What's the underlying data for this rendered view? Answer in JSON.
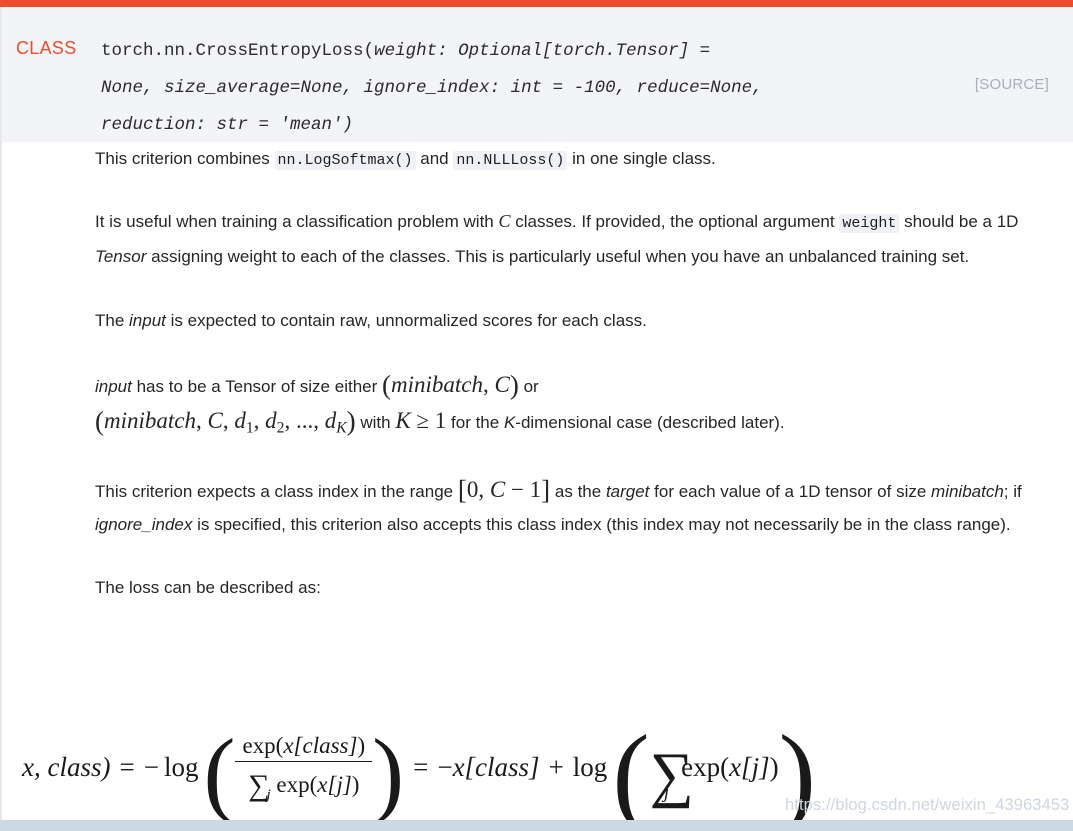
{
  "theme": {
    "brand_color": "#ee4c2c",
    "signature_bg": "#f3f4f7",
    "inline_code_bg": "#eff1f6",
    "source_link_color": "#a9aeb8",
    "body_text_color": "#262626",
    "watermark_color": "#cdd6e0",
    "bottom_strip_color": "#ccd9e4"
  },
  "signature": {
    "kind_label": "CLASS",
    "name": "torch.nn.CrossEntropyLoss",
    "open_paren": "(",
    "params_line1": "weight: Optional[torch.Tensor] =",
    "params_line2": "None, size_average=None, ignore_index: int = -100, reduce=None,",
    "params_line3": "reduction: str = 'mean')",
    "source_link": "[SOURCE]"
  },
  "body": {
    "p1": {
      "t1": "This criterion combines ",
      "code1": "nn.LogSoftmax()",
      "t2": " and ",
      "code2": "nn.NLLLoss()",
      "t3": " in one single class."
    },
    "p2": {
      "t1": "It is useful when training a classification problem with ",
      "var_c": "C",
      "t2": " classes. If provided, the optional argument ",
      "code1": "weight",
      "t3": " should be a 1D ",
      "em1": "Tensor",
      "t4": " assigning weight to each of the classes. This is particularly useful when you have an unbalanced training set."
    },
    "p3": {
      "t1": "The ",
      "em1": "input",
      "t2": " is expected to contain raw, unnormalized scores for each class."
    },
    "p4": {
      "em1": "input",
      "t1": " has to be a Tensor of size either ",
      "math1": "(minibatch, C)",
      "t2": " or ",
      "math2": "(minibatch, C, d1, d2, ..., dK)",
      "t3": " with ",
      "math3": "K ≥ 1",
      "t4": " for the ",
      "em2": "K",
      "t5": "-dimensional case (described later)."
    },
    "p5": {
      "t1": "This criterion expects a class index in the range ",
      "math1": "[0, C − 1]",
      "t2": " as the ",
      "em1": "target",
      "t3": " for each value of a 1D tensor of size ",
      "em2": "minibatch",
      "t4": "; if ",
      "em3": "ignore_index",
      "t5": " is specified, this criterion also accepts this class index (this index may not necessarily be in the class range)."
    },
    "p6": {
      "t1": "The loss can be described as:"
    }
  },
  "equation": {
    "latex": "loss(x, class) = -\\log\\left(\\frac{\\exp(x[class])}{\\sum_j \\exp(x[j])}\\right) = -x[class] + \\log\\left(\\sum_j \\exp(x[j])\\right)",
    "visible_start": "x, class)",
    "eq_sign": "=",
    "minus": "−",
    "log": "log",
    "numerator_fn": "exp",
    "numerator_arg": "x[class]",
    "denominator_sum": "∑",
    "denominator_sub": "j",
    "denominator_fn": "exp",
    "denominator_arg": "x[j]",
    "rhs_term": "x[class]",
    "plus": "+",
    "rhs_sum": "∑",
    "rhs_sum_sub": "j",
    "rhs_fn": "exp",
    "rhs_arg": "x[j]"
  },
  "watermark": {
    "text": "https://blog.csdn.net/weixin_43963453"
  }
}
